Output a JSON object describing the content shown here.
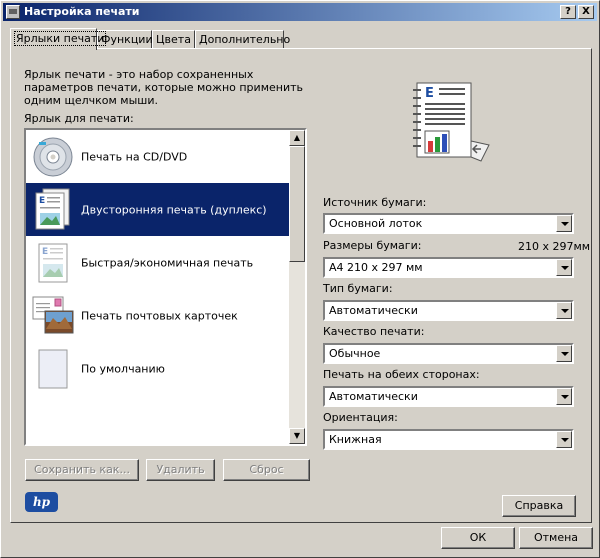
{
  "window": {
    "title": "Настройка печати",
    "help_btn": "?",
    "close_btn": "X"
  },
  "tabs": [
    {
      "label": "Ярлыки печати",
      "active": true
    },
    {
      "label": "Функции"
    },
    {
      "label": "Цвета"
    },
    {
      "label": "Дополнительно"
    }
  ],
  "description": "Ярлык печати - это набор сохраненных параметров печати, которые можно применить одним щелчком мыши.",
  "shortcuts_label": "Ярлык для печати:",
  "shortcuts": [
    {
      "label": "Печать на CD/DVD",
      "icon": "cd-dvd-icon"
    },
    {
      "label": "Двусторонняя печать (дуплекс)",
      "icon": "duplex-document-icon",
      "selected": true
    },
    {
      "label": "Быстрая/экономичная печать",
      "icon": "economy-document-icon"
    },
    {
      "label": "Печать почтовых карточек",
      "icon": "postcard-icon"
    },
    {
      "label": "По умолчанию",
      "icon": "blank-page-icon"
    }
  ],
  "buttons": {
    "save_as": "Сохранить как...",
    "delete": "Удалить",
    "reset": "Сброс",
    "help": "Справка",
    "ok": "ОК",
    "cancel": "Отмена"
  },
  "settings": {
    "paper_source": {
      "label": "Источник бумаги:",
      "value": "Основной лоток"
    },
    "paper_size": {
      "label": "Размеры бумаги:",
      "dims": "210 x 297мм",
      "value": "А4 210 x 297 мм"
    },
    "paper_type": {
      "label": "Тип бумаги:",
      "value": "Автоматически"
    },
    "print_quality": {
      "label": "Качество печати:",
      "value": "Обычное"
    },
    "duplex": {
      "label": "Печать на обеих сторонах:",
      "value": "Автоматически"
    },
    "orientation": {
      "label": "Ориентация:",
      "value": "Книжная"
    }
  },
  "logo": {
    "text": "hp"
  },
  "colors": {
    "selection": "#0a246a",
    "face": "#d4d0c8"
  }
}
